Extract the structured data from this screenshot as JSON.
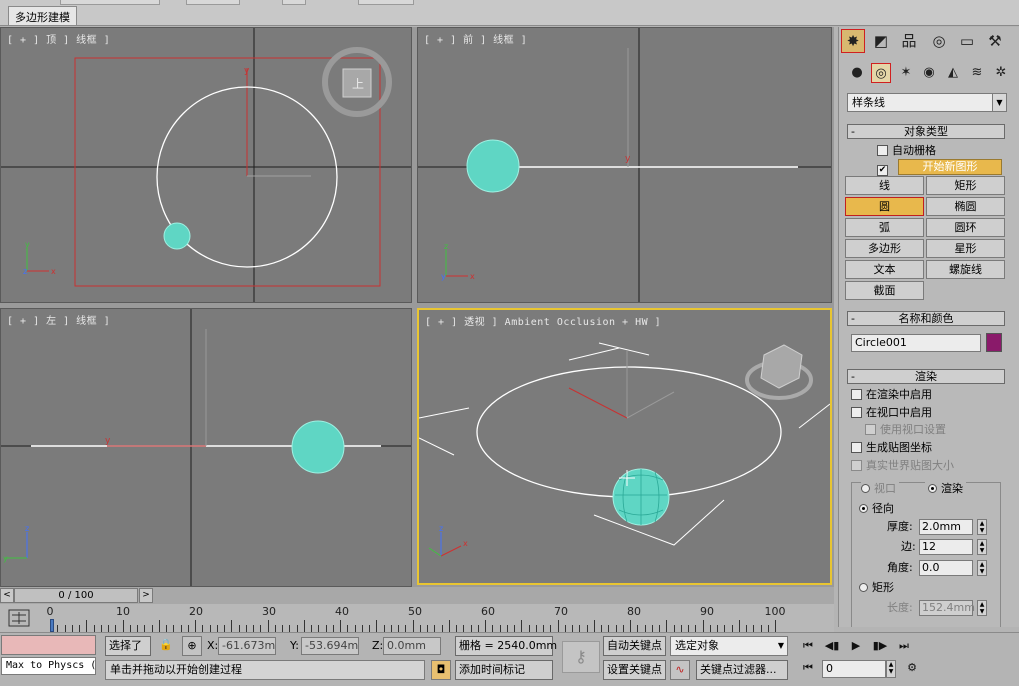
{
  "ribbon": {
    "tab_label": "多边形建模"
  },
  "viewports": {
    "top": {
      "label": "[ + ] 顶 ] 线框 ]"
    },
    "front": {
      "label": "[ + ] 前 ] 线框 ]"
    },
    "left": {
      "label": "[ + ] 左 ] 线框 ]"
    },
    "perspective": {
      "label": "[ + ] 透视 ] Ambient Occlusion + HW ]"
    }
  },
  "time_slider": {
    "position_text": "0 / 100",
    "left_arrow": "<",
    "right_arrow": ">"
  },
  "trackbar": {
    "ticks": [
      "0",
      "10",
      "20",
      "30",
      "40",
      "50",
      "60",
      "70",
      "80",
      "90",
      "100"
    ]
  },
  "status": {
    "script_listener": "Max to Physcs (",
    "selection_label": "选择了",
    "x_label": "X:",
    "x_value": "-61.673mm",
    "y_label": "Y:",
    "y_value": "-53.694mm",
    "z_label": "Z:",
    "z_value": "0.0mm",
    "grid_text": "栅格 = 2540.0mm",
    "prompt_text": "单击并拖动以开始创建过程",
    "add_time_tag": "添加时间标记",
    "auto_key": "自动关键点",
    "set_key": "设置关键点",
    "selection_set": "选定对象",
    "key_filters": "关键点过滤器...",
    "frame_value": "0"
  },
  "command_panel": {
    "category_dropdown": "样条线",
    "object_type": {
      "title": "对象类型",
      "auto_grid": "自动栅格",
      "start_new_shape": "开始新图形",
      "buttons": [
        "线",
        "矩形",
        "圆",
        "椭圆",
        "弧",
        "圆环",
        "多边形",
        "星形",
        "文本",
        "螺旋线",
        "截面"
      ]
    },
    "name_color": {
      "title": "名称和颜色",
      "name_value": "Circle001",
      "color": "#8a1a6a"
    },
    "rendering": {
      "title": "渲染",
      "enable_in_renderer": "在渲染中启用",
      "enable_in_viewport": "在视口中启用",
      "use_viewport_settings": "使用视口设置",
      "generate_mapping": "生成贴图坐标",
      "real_world_map": "真实世界贴图大小",
      "viewport_radio": "视口",
      "renderer_radio": "渲染",
      "radial": "径向",
      "thickness_label": "厚度:",
      "thickness_value": "2.0mm",
      "sides_label": "边:",
      "sides_value": "12",
      "angle_label": "角度:",
      "angle_value": "0.0",
      "rectangular": "矩形",
      "length_label": "长度:",
      "length_value": "152.4mm"
    }
  },
  "colors": {
    "accent_yellow": "#e8c531",
    "selection_red": "#d02020",
    "sphere_cyan": "#5fd6c4",
    "viewport_gray": "#7b7b7b"
  }
}
